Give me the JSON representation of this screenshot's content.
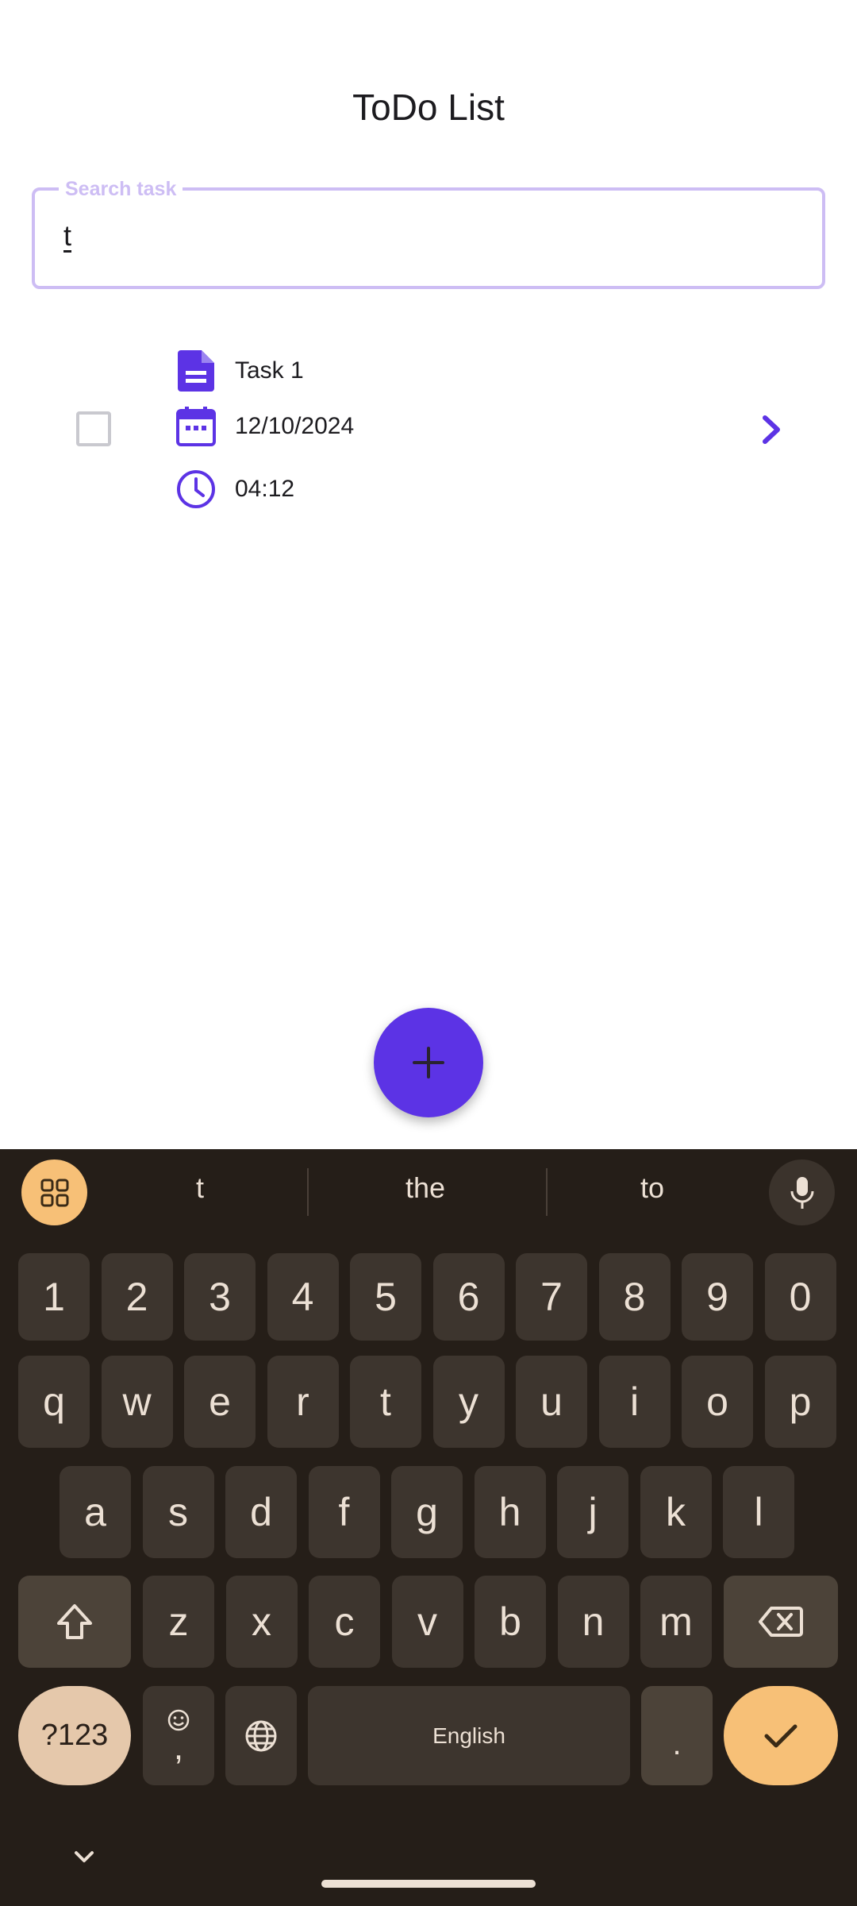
{
  "app": {
    "title": "ToDo List",
    "search": {
      "label": "Search task",
      "value": "t"
    },
    "tasks": [
      {
        "name": "Task 1",
        "date": "12/10/2024",
        "time": "04:12",
        "done": false
      }
    ],
    "colors": {
      "accent": "#5c33e5",
      "search_border": "#cdbdf4"
    }
  },
  "keyboard": {
    "suggestions": [
      "t",
      "the",
      "to"
    ],
    "row_numbers": [
      "1",
      "2",
      "3",
      "4",
      "5",
      "6",
      "7",
      "8",
      "9",
      "0"
    ],
    "row_q": [
      "q",
      "w",
      "e",
      "r",
      "t",
      "y",
      "u",
      "i",
      "o",
      "p"
    ],
    "row_a": [
      "a",
      "s",
      "d",
      "f",
      "g",
      "h",
      "j",
      "k",
      "l"
    ],
    "row_z": [
      "z",
      "x",
      "c",
      "v",
      "b",
      "n",
      "m"
    ],
    "symbols_key": "?123",
    "comma_key": ",",
    "space_label": "English",
    "period_key": "."
  }
}
